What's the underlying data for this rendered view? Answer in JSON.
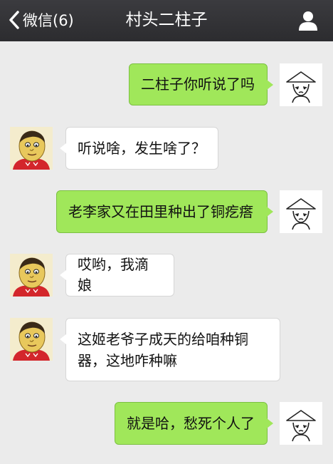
{
  "header": {
    "back_label": "微信(6)",
    "title": "村头二柱子"
  },
  "messages": [
    {
      "side": "right",
      "text": "二柱子你听说了吗"
    },
    {
      "side": "left",
      "text": "听说啥，发生啥了？"
    },
    {
      "side": "right",
      "text": "老李家又在田里种出了铜疙瘩"
    },
    {
      "side": "left",
      "text": "哎哟，我滴娘"
    },
    {
      "side": "left",
      "text": "这姬老爷子成天的给咱种铜器，这地咋种嘛"
    },
    {
      "side": "right",
      "text": "就是哈，愁死个人了"
    }
  ],
  "colors": {
    "header_bg": "#333336",
    "chat_bg": "#ebebeb",
    "sent_bubble": "#a0e75a",
    "received_bubble": "#ffffff"
  },
  "icons": {
    "back": "chevron-left-icon",
    "profile": "user-icon"
  }
}
